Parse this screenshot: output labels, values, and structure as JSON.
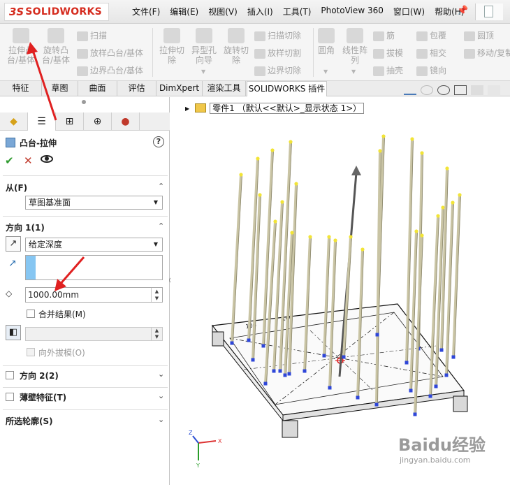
{
  "app": {
    "brand": "SOLIDWORKS"
  },
  "menu": [
    "文件(F)",
    "编辑(E)",
    "视图(V)",
    "插入(I)",
    "工具(T)",
    "PhotoView 360",
    "窗口(W)",
    "帮助(H)"
  ],
  "ribbon": {
    "extrude_boss": "拉伸凸\n台/基体",
    "revolve_boss": "旋转凸\n台/基体",
    "sweep": "扫描",
    "loft": "放样凸台/基体",
    "boundary": "边界凸台/基体",
    "extrude_cut": "拉伸切\n除",
    "hole_wizard": "异型孔\n向导",
    "revolve_cut": "旋转切\n除",
    "swept_cut": "扫描切除",
    "lofted_cut": "放样切割",
    "boundary_cut": "边界切除",
    "fillet": "圆角",
    "linear_pattern": "线性阵\n列",
    "rib": "筋",
    "draft": "拔模",
    "shell": "抽壳",
    "wrap": "包覆",
    "intersect": "相交",
    "mirror": "镜向",
    "dome": "圆顶",
    "move_copy": "移动/复制"
  },
  "tabs": [
    "特征",
    "草图",
    "曲面",
    "评估",
    "DimXpert",
    "渲染工具",
    "SOLIDWORKS 插件"
  ],
  "property_manager": {
    "title": "凸台-拉伸",
    "from_title": "从(F)",
    "from_value": "草图基准面",
    "dir1_title": "方向 1(1)",
    "end_condition": "给定深度",
    "depth_value": "1000.00mm",
    "merge_result": "合并结果(M)",
    "draft_outward": "向外拔模(O)",
    "dir2_title": "方向 2(2)",
    "thin_feature": "薄壁特征(T)",
    "selected_contours": "所选轮廓(S)"
  },
  "tree": {
    "label": "零件1 （默认<<默认>_显示状态 1>）"
  },
  "watermark": {
    "main": "Baidu经验",
    "sub": "jingyan.baidu.com"
  },
  "colors": {
    "brand_red": "#d52b1e",
    "annotation_red": "#e02020",
    "selection_blue": "#86c6f2"
  }
}
